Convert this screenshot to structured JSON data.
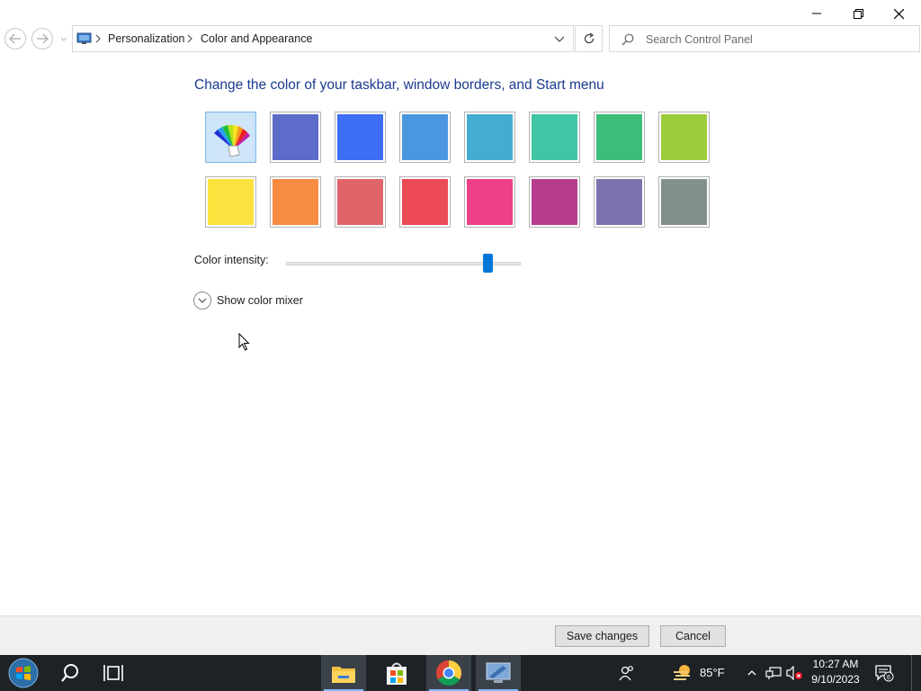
{
  "window": {
    "caption_buttons": [
      "minimize",
      "restore",
      "close"
    ]
  },
  "navigation": {
    "breadcrumbs": [
      "Personalization",
      "Color and Appearance"
    ],
    "search": {
      "placeholder": "Search Control Panel"
    }
  },
  "main": {
    "heading": "Change the color of your taskbar, window borders, and Start menu",
    "swatches": [
      {
        "name": "custom-palette",
        "color": "#cfe6fa",
        "selected": true
      },
      {
        "name": "slate-blue",
        "color": "#5c6cc8"
      },
      {
        "name": "bright-blue",
        "color": "#3d6ef5"
      },
      {
        "name": "sky-blue",
        "color": "#4a97e0"
      },
      {
        "name": "teal-blue",
        "color": "#44acd0"
      },
      {
        "name": "sea-green",
        "color": "#40c5a5"
      },
      {
        "name": "green",
        "color": "#3dbd7a"
      },
      {
        "name": "lime",
        "color": "#9dcc3c"
      },
      {
        "name": "yellow",
        "color": "#fbe23e"
      },
      {
        "name": "orange",
        "color": "#f88b42"
      },
      {
        "name": "salmon",
        "color": "#e0656b"
      },
      {
        "name": "red",
        "color": "#eb4a56"
      },
      {
        "name": "pink",
        "color": "#ed3f8a"
      },
      {
        "name": "magenta",
        "color": "#b83c8e"
      },
      {
        "name": "lavender",
        "color": "#7c73ae"
      },
      {
        "name": "gray-green",
        "color": "#84918a"
      }
    ],
    "intensity": {
      "label": "Color intensity:",
      "value_fraction": 0.86
    },
    "mixer": {
      "label": "Show color mixer"
    }
  },
  "footer": {
    "save_label": "Save changes",
    "cancel_label": "Cancel"
  },
  "taskbar": {
    "weather": "85°F",
    "time": "10:27 AM",
    "date": "9/10/2023",
    "notification_count": "6",
    "pinned_apps": [
      "file-explorer",
      "microsoft-store",
      "chrome",
      "remote-desktop"
    ],
    "accent_color": "#0078d7"
  }
}
